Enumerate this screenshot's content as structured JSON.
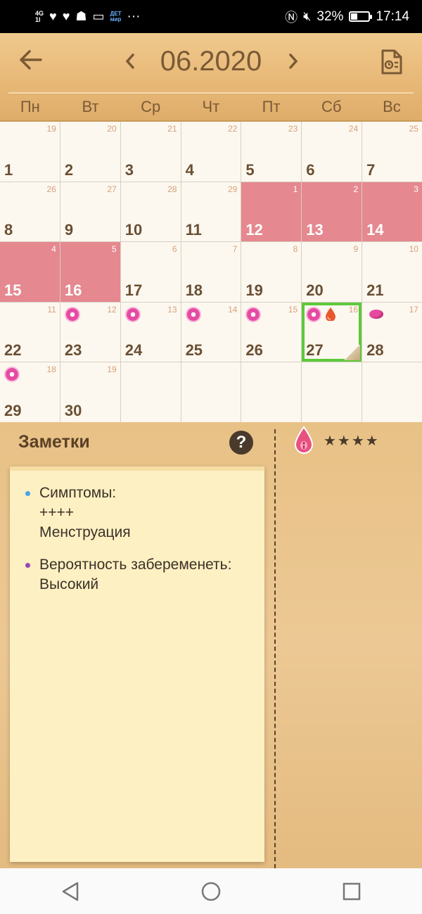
{
  "status_bar": {
    "network": "4G",
    "signal_extra": "1l",
    "detmir_top": "ДЕТ",
    "detmir_bottom": "мир",
    "more": "···",
    "battery": "32%",
    "time": "17:14",
    "icons": [
      "signal-icon",
      "heart-icon",
      "heart-icon",
      "moneybox-icon",
      "app-icon",
      "detmir-icon",
      "nfc-icon",
      "mute-icon",
      "battery-icon"
    ]
  },
  "header": {
    "month": "06.2020",
    "back_icon": "arrow-left-icon",
    "prev_icon": "chevron-left-icon",
    "next_icon": "chevron-right-icon",
    "report_icon": "document-report-icon",
    "weekdays": [
      "Пн",
      "Вт",
      "Ср",
      "Чт",
      "Пт",
      "Сб",
      "Вс"
    ]
  },
  "calendar": {
    "weeks": [
      [
        {
          "day": "1",
          "cycle": "19"
        },
        {
          "day": "2",
          "cycle": "20"
        },
        {
          "day": "3",
          "cycle": "21"
        },
        {
          "day": "4",
          "cycle": "22"
        },
        {
          "day": "5",
          "cycle": "23"
        },
        {
          "day": "6",
          "cycle": "24"
        },
        {
          "day": "7",
          "cycle": "25"
        }
      ],
      [
        {
          "day": "8",
          "cycle": "26"
        },
        {
          "day": "9",
          "cycle": "27"
        },
        {
          "day": "10",
          "cycle": "28"
        },
        {
          "day": "11",
          "cycle": "29"
        },
        {
          "day": "12",
          "cycle": "1",
          "period": true
        },
        {
          "day": "13",
          "cycle": "2",
          "period": true
        },
        {
          "day": "14",
          "cycle": "3",
          "period": true
        }
      ],
      [
        {
          "day": "15",
          "cycle": "4",
          "period": true
        },
        {
          "day": "16",
          "cycle": "5",
          "period": true
        },
        {
          "day": "17",
          "cycle": "6"
        },
        {
          "day": "18",
          "cycle": "7"
        },
        {
          "day": "19",
          "cycle": "8"
        },
        {
          "day": "20",
          "cycle": "9"
        },
        {
          "day": "21",
          "cycle": "10"
        }
      ],
      [
        {
          "day": "22",
          "cycle": "11"
        },
        {
          "day": "23",
          "cycle": "12",
          "icons": [
            "flower-icon"
          ]
        },
        {
          "day": "24",
          "cycle": "13",
          "icons": [
            "flower-icon"
          ]
        },
        {
          "day": "25",
          "cycle": "14",
          "icons": [
            "flower-icon"
          ]
        },
        {
          "day": "26",
          "cycle": "15",
          "icons": [
            "flower-icon"
          ]
        },
        {
          "day": "27",
          "cycle": "16",
          "icons": [
            "flower-icon",
            "drop-icon"
          ],
          "selected": true
        },
        {
          "day": "28",
          "cycle": "17",
          "icons": [
            "pill-icon"
          ]
        }
      ],
      [
        {
          "day": "29",
          "cycle": "18",
          "icons": [
            "flower-icon"
          ]
        },
        {
          "day": "30",
          "cycle": "19"
        },
        {
          "empty": true
        },
        {
          "empty": true
        },
        {
          "empty": true
        },
        {
          "empty": true
        },
        {
          "empty": true
        }
      ]
    ],
    "colors": {
      "period": "#e5888f",
      "selected": "#5cc93b",
      "flower": "#e64aa3"
    }
  },
  "notes": {
    "title": "Заметки",
    "help_label": "?",
    "stars": "★★★★",
    "badge_icon": "blood-drop-icon",
    "items": [
      {
        "dot": "#4aa3e8",
        "lines": [
          "Симптомы:",
          "++++",
          "Менструация"
        ]
      },
      {
        "dot": "#9a45b8",
        "lines": [
          "Вероятность забеременеть:",
          "Высокий"
        ]
      }
    ]
  },
  "nav": {
    "icons": [
      "back-triangle-icon",
      "home-circle-icon",
      "recents-square-icon"
    ]
  }
}
